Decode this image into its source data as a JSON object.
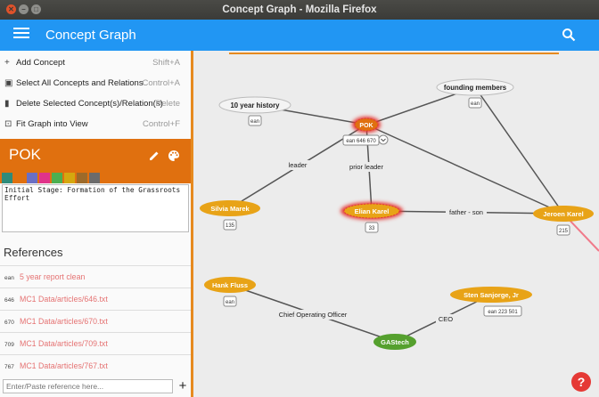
{
  "window": {
    "title": "Concept Graph - Mozilla Firefox"
  },
  "appbar": {
    "title": "Concept Graph",
    "menu_icon": "hamburger-icon",
    "search_icon": "search-icon"
  },
  "menu": [
    {
      "label": "Add Concept",
      "shortcut": "Shift+A",
      "icon": "+"
    },
    {
      "label": "Select All Concepts and Relations",
      "shortcut": "Control+A",
      "icon": "▣"
    },
    {
      "label": "Delete Selected Concept(s)/Relation(s)",
      "shortcut": "Delete",
      "icon": "▮"
    },
    {
      "label": "Fit Graph into View",
      "shortcut": "Control+F",
      "icon": "⊡"
    }
  ],
  "node": {
    "title": "POK",
    "color": "#e0700f",
    "swatches": [
      "#2e8b7a",
      "#e0700f",
      "#6a6fc4",
      "#e0338a",
      "#4caf50",
      "#d4a80f",
      "#9c6a2a",
      "#6b6b6b"
    ],
    "description": "Initial Stage: Formation of the Grassroots\nEffort"
  },
  "references": {
    "title": "References",
    "items": [
      {
        "id": "ean",
        "text": "5 year report clean"
      },
      {
        "id": "646",
        "text": "MC1 Data/articles/646.txt"
      },
      {
        "id": "670",
        "text": "MC1 Data/articles/670.txt"
      },
      {
        "id": "709",
        "text": "MC1 Data/articles/709.txt"
      },
      {
        "id": "767",
        "text": "MC1 Data/articles/767.txt"
      }
    ],
    "input_placeholder": "Enter/Paste reference here...",
    "add_label": "+"
  },
  "graph": {
    "nodes": {
      "history": {
        "label": "10 year history",
        "ref": "ean"
      },
      "founding": {
        "label": "founding members",
        "ref": "ean"
      },
      "pok": {
        "label": "POK",
        "ref": "ean 646 670"
      },
      "silvia": {
        "label": "Silvia Marek",
        "ref": "135"
      },
      "elian": {
        "label": "Elian Karel",
        "ref": "33"
      },
      "jeroen": {
        "label": "Jeroen Karel",
        "ref": "215"
      },
      "hank": {
        "label": "Hank Fluss",
        "ref": "ean"
      },
      "sten": {
        "label": "Sten Sanjorge, Jr",
        "ref": "ean 223 501"
      },
      "gastech": {
        "label": "GAStech",
        "ref": ""
      }
    },
    "edges": {
      "leader": "leader",
      "prior_leader": "prior leader",
      "father_son": "father - son",
      "coo": "Chief Operating Officer",
      "ceo": "CEO"
    },
    "colors": {
      "concept": "#e8a317",
      "selected_glow": "#e53935",
      "gastech": "#55a02e",
      "plain": "#f2f2f2"
    }
  },
  "help": {
    "label": "?"
  }
}
